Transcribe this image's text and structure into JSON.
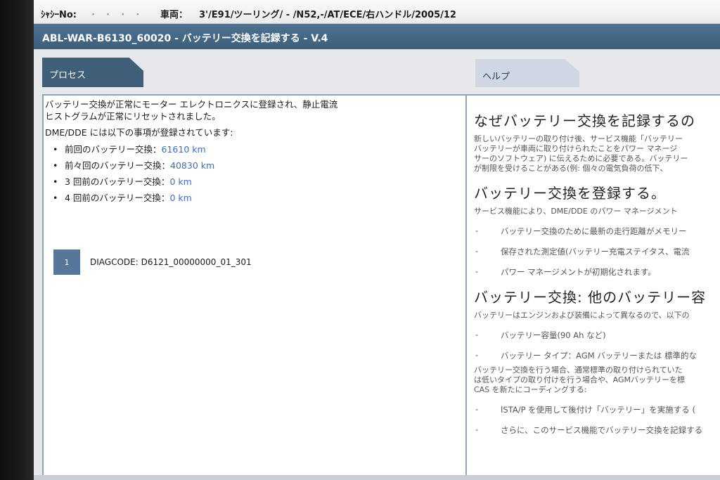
{
  "header": {
    "chassis_label": "ｼｬｼｰNo:",
    "chassis_value": "・ ・ ・ ・",
    "vehicle_label": "車両：",
    "vehicle_value": "3'/E91/ツーリング/ - /N52,-/AT/ECE/右ハンドル/2005/12"
  },
  "title": "ABL-WAR-B6130_60020 - バッテリー交換を記録する - V.4",
  "tabs": {
    "process": "プロセス",
    "help": "ヘルプ"
  },
  "process": {
    "intro_line1": "バッテリー交換が正常にモーター エレクトロニクスに登録され、静止電流",
    "intro_line2": "ヒストグラムが正常にリセットされました。",
    "subhead": "DME/DDE には以下の事項が登録されています:",
    "items": [
      {
        "label": "前回のバッテリー交換：",
        "value": "61610 km"
      },
      {
        "label": "前々回のバッテリー交換：",
        "value": "40830 km"
      },
      {
        "label": "3 回前のバッテリー交換：",
        "value": "0 km"
      },
      {
        "label": "4 回前のバッテリー交換：",
        "value": "0 km"
      }
    ],
    "diag_number": "1",
    "diag_code": "DIAGCODE: D6121_00000000_01_301"
  },
  "help": {
    "heading1": "なぜバッテリー交換を記録するの",
    "text1_line1": "新しいバッテリーの取り付け後、サービス機能「バッテリー",
    "text1_line2": "バッテリーが車両に取り付けられたことをパワー マネージ",
    "text1_line3": "サーのソフトウェア) に伝えるために必要である。バッテリー",
    "text1_line4": "が制限を受けることがある(例: 個々の電気負荷の低下、",
    "heading2": "バッテリー交換を登録する。",
    "text2": "サービス機能により、DME/DDE のパワー マネージメント",
    "dash2_1": "バッテリー交換のために最新の走行距離がメモリー",
    "dash2_2": "保存された測定値(バッテリー充電ステイタス、電流",
    "dash2_3": "パワー マネージメントが初期化されます。",
    "heading3": "バッテリー交換: 他のバッテリー容",
    "text3": "バッテリーはエンジンおよび装備によって異なるので、以下の",
    "dash3_1": "バッテリー容量(90 Ah など)",
    "dash3_2": "バッテリー タイプ：AGM バッテリーまたは 標準的な",
    "text4_line1": "バッテリー交換を行う場合、通常標準の取り付けられていた",
    "text4_line2": "は低いタイプの取り付けを行う場合や、AGMバッテリーを標",
    "text4_line3": "CAS を新たにコーディングする:",
    "dash4_1": "ISTA/P を使用して後付け「バッテリー」を実施する (",
    "dash4_2": "さらに、このサービス機能でバッテリー交換を記録する"
  },
  "colors": {
    "title_bar": "#4a6d8c",
    "process_tab": "#3f5f78",
    "help_tab": "#cfd6e4",
    "km_value": "#3a6fc4",
    "diag_badge": "#56779a"
  }
}
